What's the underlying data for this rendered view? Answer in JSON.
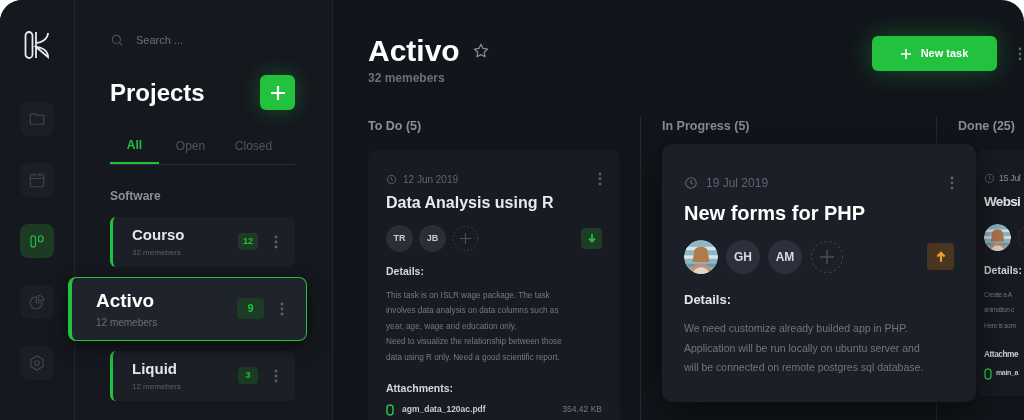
{
  "rail": {
    "items": [
      {
        "kind": "folder",
        "selected": false
      },
      {
        "kind": "calendar",
        "selected": false
      },
      {
        "kind": "board",
        "selected": true
      },
      {
        "kind": "chart",
        "selected": false
      },
      {
        "kind": "settings",
        "selected": false
      }
    ]
  },
  "projects": {
    "search": {
      "placeholder": "Search ..."
    },
    "title": "Projects",
    "tabs": [
      {
        "label": "All",
        "selected": true
      },
      {
        "label": "Open",
        "selected": false
      },
      {
        "label": "Closed",
        "selected": false
      }
    ],
    "groups": [
      {
        "label": "Software",
        "items": [
          {
            "name": "Courso",
            "members": "32 memebers",
            "count": "12",
            "selected": false
          },
          {
            "name": "Activo",
            "members": "12 memebers",
            "count": "9",
            "selected": true
          },
          {
            "name": "Liquid",
            "members": "12 memebers",
            "count": "3",
            "selected": false
          }
        ]
      }
    ]
  },
  "board": {
    "title": "Activo",
    "starred": false,
    "members": "32 memebers",
    "new_task": "New task",
    "columns": [
      {
        "title": "To Do (5)",
        "cards": [
          {
            "selected": false,
            "date": "12 Jun 2019",
            "title": "Data Analysis using R",
            "assignees": [
              {
                "kind": "initials",
                "text": "TR"
              },
              {
                "kind": "initials",
                "text": "JB"
              }
            ],
            "high_priority": false,
            "details_label": "Details:",
            "details": [
              "This task is on ISLR wage package. The task involves data analysis on data columns such as year, age, wage and education only.",
              "Need to visualize the relationship between those data using R only. Need a good scientific report."
            ],
            "attachments_label": "Attachments:",
            "attachments": [
              {
                "name": "agm_data_120ac.pdf",
                "size": "354.42 KB"
              }
            ]
          }
        ]
      },
      {
        "title": "In Progress (5)",
        "cards": [
          {
            "selected": true,
            "date": "19 Jul 2019",
            "title": "New forms for PHP",
            "assignees": [
              {
                "kind": "picture"
              },
              {
                "kind": "initials",
                "text": "GH"
              },
              {
                "kind": "initials",
                "text": "AM"
              }
            ],
            "high_priority": true,
            "details_label": "Details:",
            "details": [
              "We need customize already builded app in PHP. Application will be run locally on ubuntu server and will be connected on remote postgres sql database."
            ]
          }
        ]
      },
      {
        "title": "Done (25)",
        "cards": [
          {
            "selected": false,
            "date": "15 Jul",
            "title": "Websi",
            "assignees": [
              {
                "kind": "picture"
              }
            ],
            "details_label": "Details:",
            "details": [
              "Create a A",
              "animation c",
              "Here is som"
            ],
            "attachments_label": "Attachme",
            "attachments": [
              {
                "name": "main_a"
              }
            ]
          }
        ]
      }
    ]
  }
}
